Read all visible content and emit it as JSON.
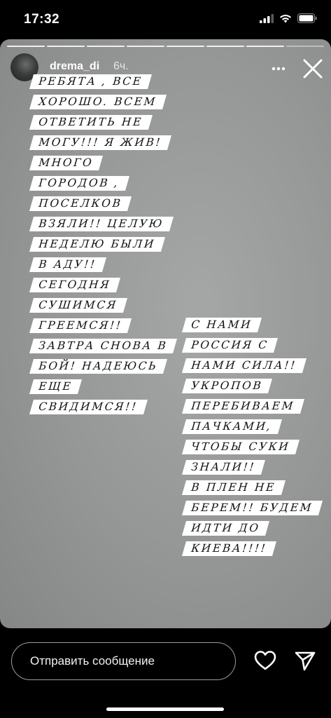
{
  "status_bar": {
    "time": "17:32"
  },
  "story": {
    "username": "drema_di",
    "time_ago": "6ч.",
    "progress": {
      "segments": 8,
      "viewed": 7
    },
    "caption_left": [
      "РЕБЯТА , ВСЕ",
      "ХОРОШО. ВСЕМ",
      "ОТВЕТИТЬ НЕ",
      "МОГУ!!! Я ЖИВ!",
      "МНОГО",
      "ГОРОДОВ ,",
      "ПОСЕЛКОВ",
      "ВЗЯЛИ!! ЦЕЛУЮ",
      "НЕДЕЛЮ БЫЛИ",
      "В АДУ!!",
      "СЕГОДНЯ",
      "СУШИМСЯ",
      "ГРЕЕМСЯ!!",
      "ЗАВТРА СНОВА В",
      "БОЙ! НАДЕЮСЬ",
      "ЕЩЕ",
      "СВИДИМСЯ!!"
    ],
    "caption_right": [
      "С НАМИ",
      "РОССИЯ С",
      "НАМИ СИЛА!!",
      "УКРОПОВ",
      "ПЕРЕБИВАЕМ",
      "ПАЧКАМИ,",
      "ЧТОБЫ СУКИ",
      "ЗНАЛИ!!",
      "В ПЛЕН НЕ",
      "БЕРЕМ!! БУДЕМ",
      "ИДТИ ДО",
      "КИЕВА!!!!"
    ]
  },
  "reply": {
    "placeholder": "Отправить сообщение"
  },
  "icons": {
    "signal": "cellular-signal-icon",
    "wifi": "wifi-icon",
    "battery": "battery-icon",
    "more": "more-horizontal-icon",
    "close": "close-icon",
    "heart": "heart-icon",
    "send": "send-icon"
  }
}
